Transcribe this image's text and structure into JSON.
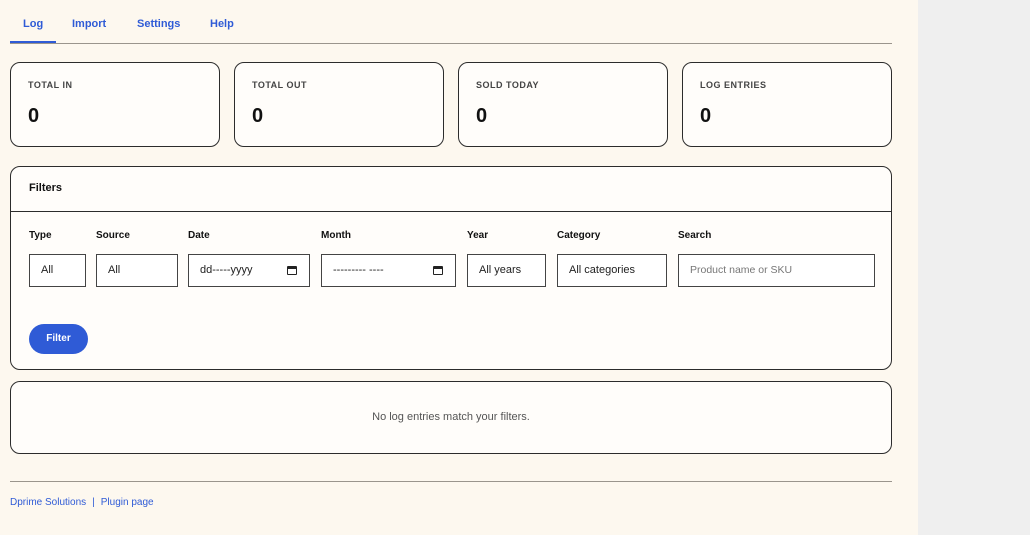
{
  "tabs": [
    {
      "label": "Log"
    },
    {
      "label": "Import"
    },
    {
      "label": "Settings"
    },
    {
      "label": "Help"
    }
  ],
  "stats": [
    {
      "label": "TOTAL IN",
      "value": "0"
    },
    {
      "label": "TOTAL OUT",
      "value": "0"
    },
    {
      "label": "SOLD TODAY",
      "value": "0"
    },
    {
      "label": "LOG ENTRIES",
      "value": "0"
    }
  ],
  "filters": {
    "title": "Filters",
    "type": {
      "label": "Type",
      "value": "All"
    },
    "source": {
      "label": "Source",
      "value": "All"
    },
    "date": {
      "label": "Date",
      "value": "dd-----yyyy"
    },
    "month": {
      "label": "Month",
      "value": "--------- ----"
    },
    "year": {
      "label": "Year",
      "value": "All years"
    },
    "category": {
      "label": "Category",
      "value": "All categories"
    },
    "search": {
      "label": "Search",
      "placeholder": "Product name or SKU"
    },
    "button_label": "Filter"
  },
  "results": {
    "empty_message": "No log entries match your filters."
  },
  "footer": {
    "link1": "Dprime Solutions",
    "separator": "|",
    "link2": "Plugin page"
  },
  "colors": {
    "accent": "#2f5bd6",
    "panel_bg": "#fdf8ef",
    "outer_bg": "#efefef"
  }
}
